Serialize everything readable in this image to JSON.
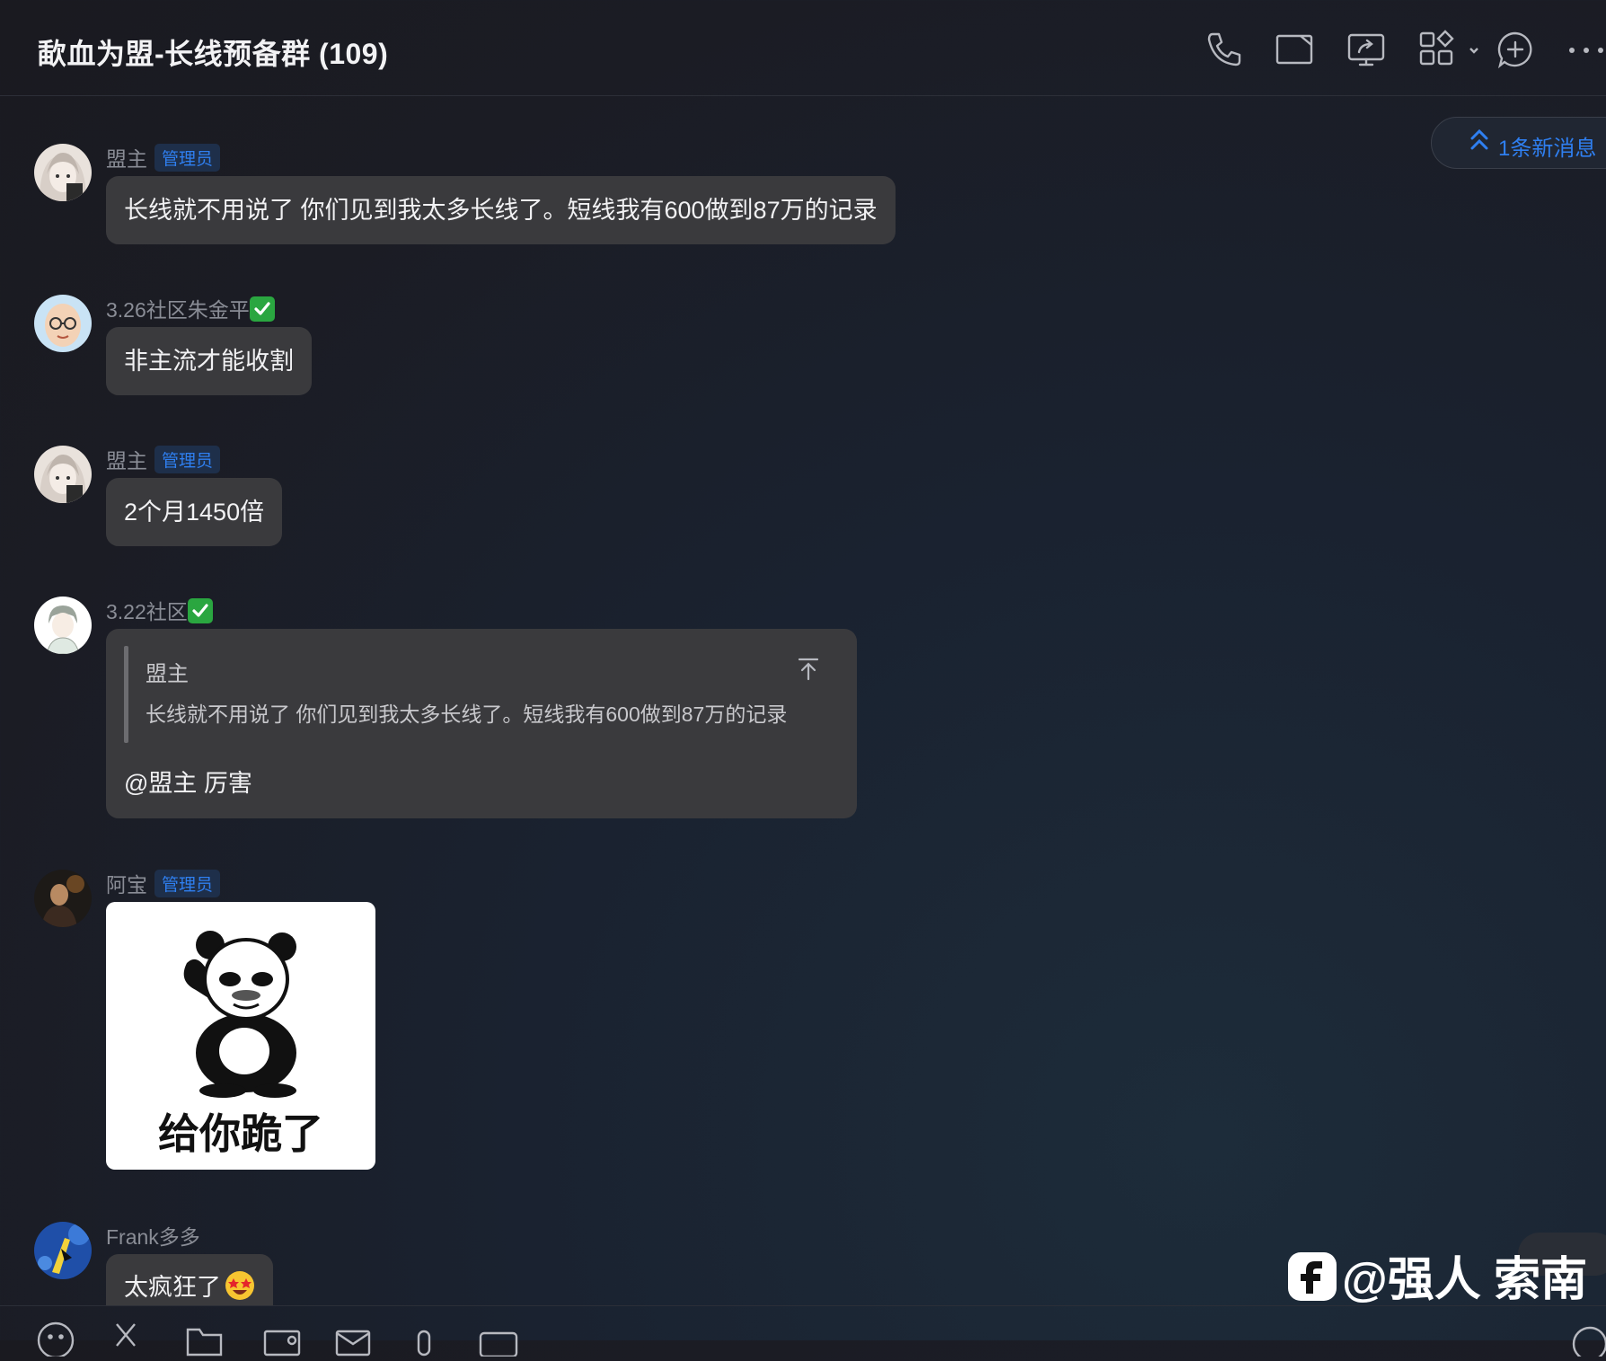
{
  "header": {
    "title": "歃血为盟-长线预备群 (109)",
    "icons": [
      "phone-icon",
      "video-icon",
      "screen-share-icon",
      "apps-icon",
      "add-chat-icon",
      "more-icon"
    ]
  },
  "new_message_pill": {
    "label": "1条新消息"
  },
  "messages": [
    {
      "sender": "盟主",
      "badge": "管理员",
      "text": "长线就不用说了 你们见到我太多长线了。短线我有600做到87万的记录"
    },
    {
      "sender": "3.26社区朱金平",
      "text": "非主流才能收割"
    },
    {
      "sender": "盟主",
      "badge": "管理员",
      "text": "2个月1450倍"
    },
    {
      "sender": "3.22社区",
      "quote": {
        "sender": "盟主",
        "text": "长线就不用说了 你们见到我太多长线了。短线我有600做到87万的记录"
      },
      "text": "@盟主 厉害"
    },
    {
      "sender": "阿宝",
      "badge": "管理员",
      "sticker_text": "给你跪了"
    },
    {
      "sender": "Frank多多",
      "text": "太疯狂了"
    }
  ],
  "watermark": {
    "text": "@强人 索南"
  },
  "colors": {
    "accent": "#2f7ff0",
    "bubble": "#3a3a3d",
    "check": "#2aa640"
  }
}
